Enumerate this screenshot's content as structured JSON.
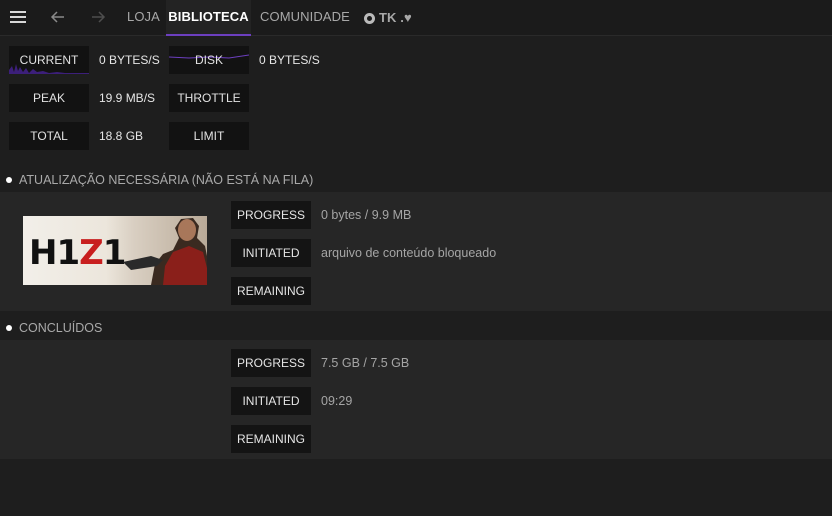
{
  "nav": {
    "tabs": {
      "loja": "LOJA",
      "biblioteca": "BIBLIOTECA",
      "comunidade": "COMUNIDADE"
    },
    "user_label": "TK .♥"
  },
  "stats": {
    "current_label": "CURRENT",
    "current_value": "0 BYTES/S",
    "disk_label": "DISK",
    "disk_value": "0 BYTES/S",
    "peak_label": "PEAK",
    "peak_value": "19.9 MB/S",
    "throttle_label": "THROTTLE",
    "total_label": "TOTAL",
    "total_value": "18.8 GB",
    "limit_label": "LIMIT"
  },
  "sections": {
    "update_required": {
      "title": "ATUALIZAÇÃO NECESSÁRIA (NÃO ESTÁ NA FILA)",
      "game_logo": {
        "prefix": "H1",
        "red": "Z",
        "suffix": "1"
      },
      "progress_label": "PROGRESS",
      "progress_value": "0 bytes / 9.9 MB",
      "initiated_label": "INITIATED",
      "initiated_value": "arquivo de conteúdo bloqueado",
      "remaining_label": "REMAINING"
    },
    "completed": {
      "title": "CONCLUÍDOS",
      "progress_label": "PROGRESS",
      "progress_value": "7.5 GB / 7.5 GB",
      "initiated_label": "INITIATED",
      "initiated_value": "09:29",
      "remaining_label": "REMAINING"
    }
  },
  "colors": {
    "accent": "#6c3fbf",
    "background": "#1e1e1e",
    "panel": "#262626"
  }
}
